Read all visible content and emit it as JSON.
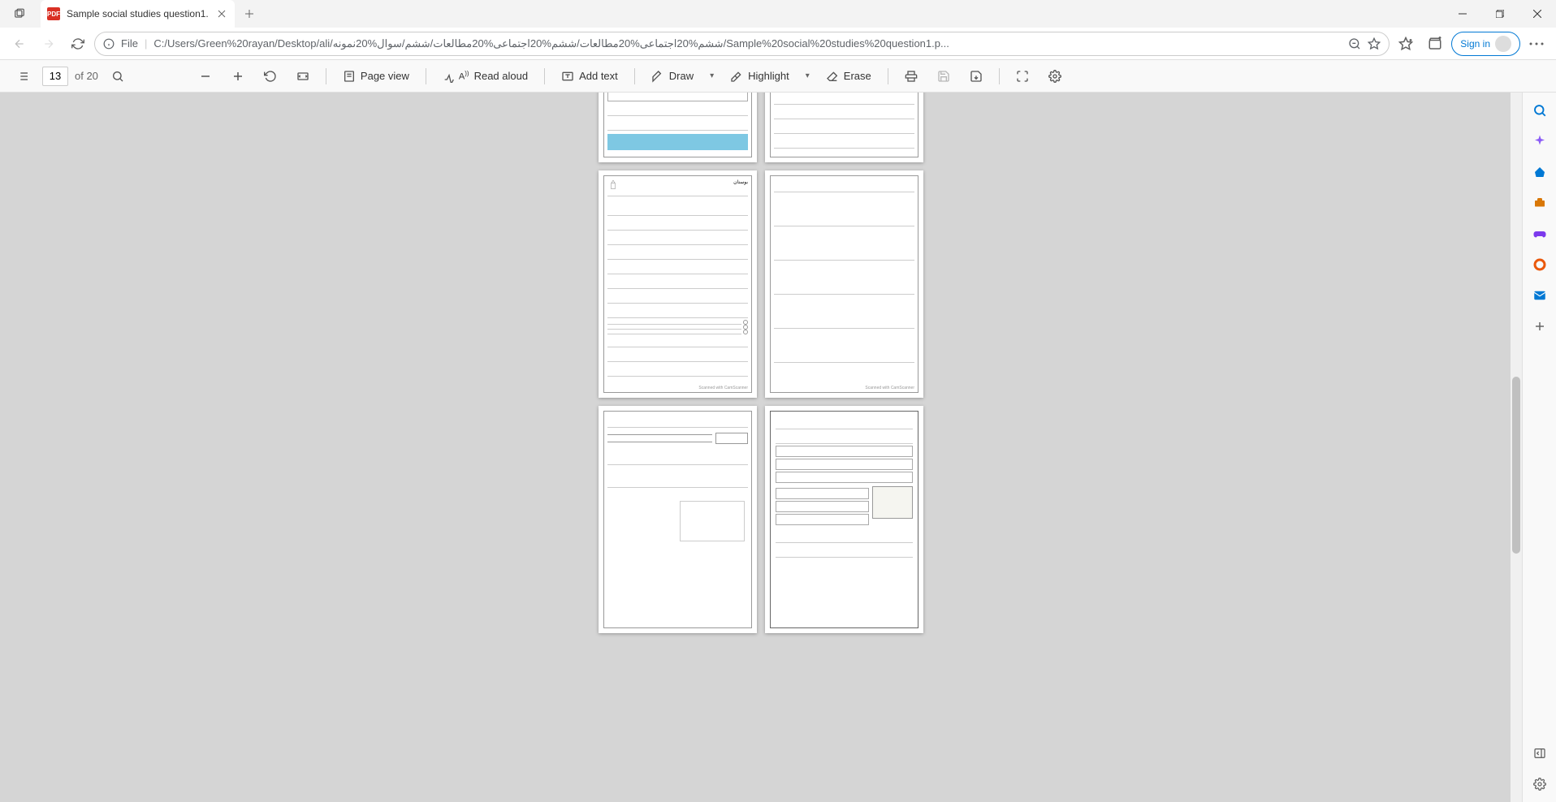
{
  "window": {
    "tab_title": "Sample social studies question1.",
    "tab_file_type": "PDF"
  },
  "address": {
    "file_label": "File",
    "url": "C:/Users/Green%20rayan/Desktop/ali/ششم%20اجتماعی%20مطالعات/ششم%20اجتماعی%20مطالعات/ششم/سوال%20نمونه/Sample%20social%20studies%20question1.p...",
    "signin": "Sign in"
  },
  "pdf_toolbar": {
    "current_page": "13",
    "total_pages": "of 20",
    "page_view": "Page view",
    "read_aloud": "Read aloud",
    "add_text": "Add text",
    "draw": "Draw",
    "highlight": "Highlight",
    "erase": "Erase"
  },
  "document": {
    "pages_visible": 6,
    "scanned_footer": "Scanned with CamScanner",
    "sample_title": "بوستان"
  }
}
